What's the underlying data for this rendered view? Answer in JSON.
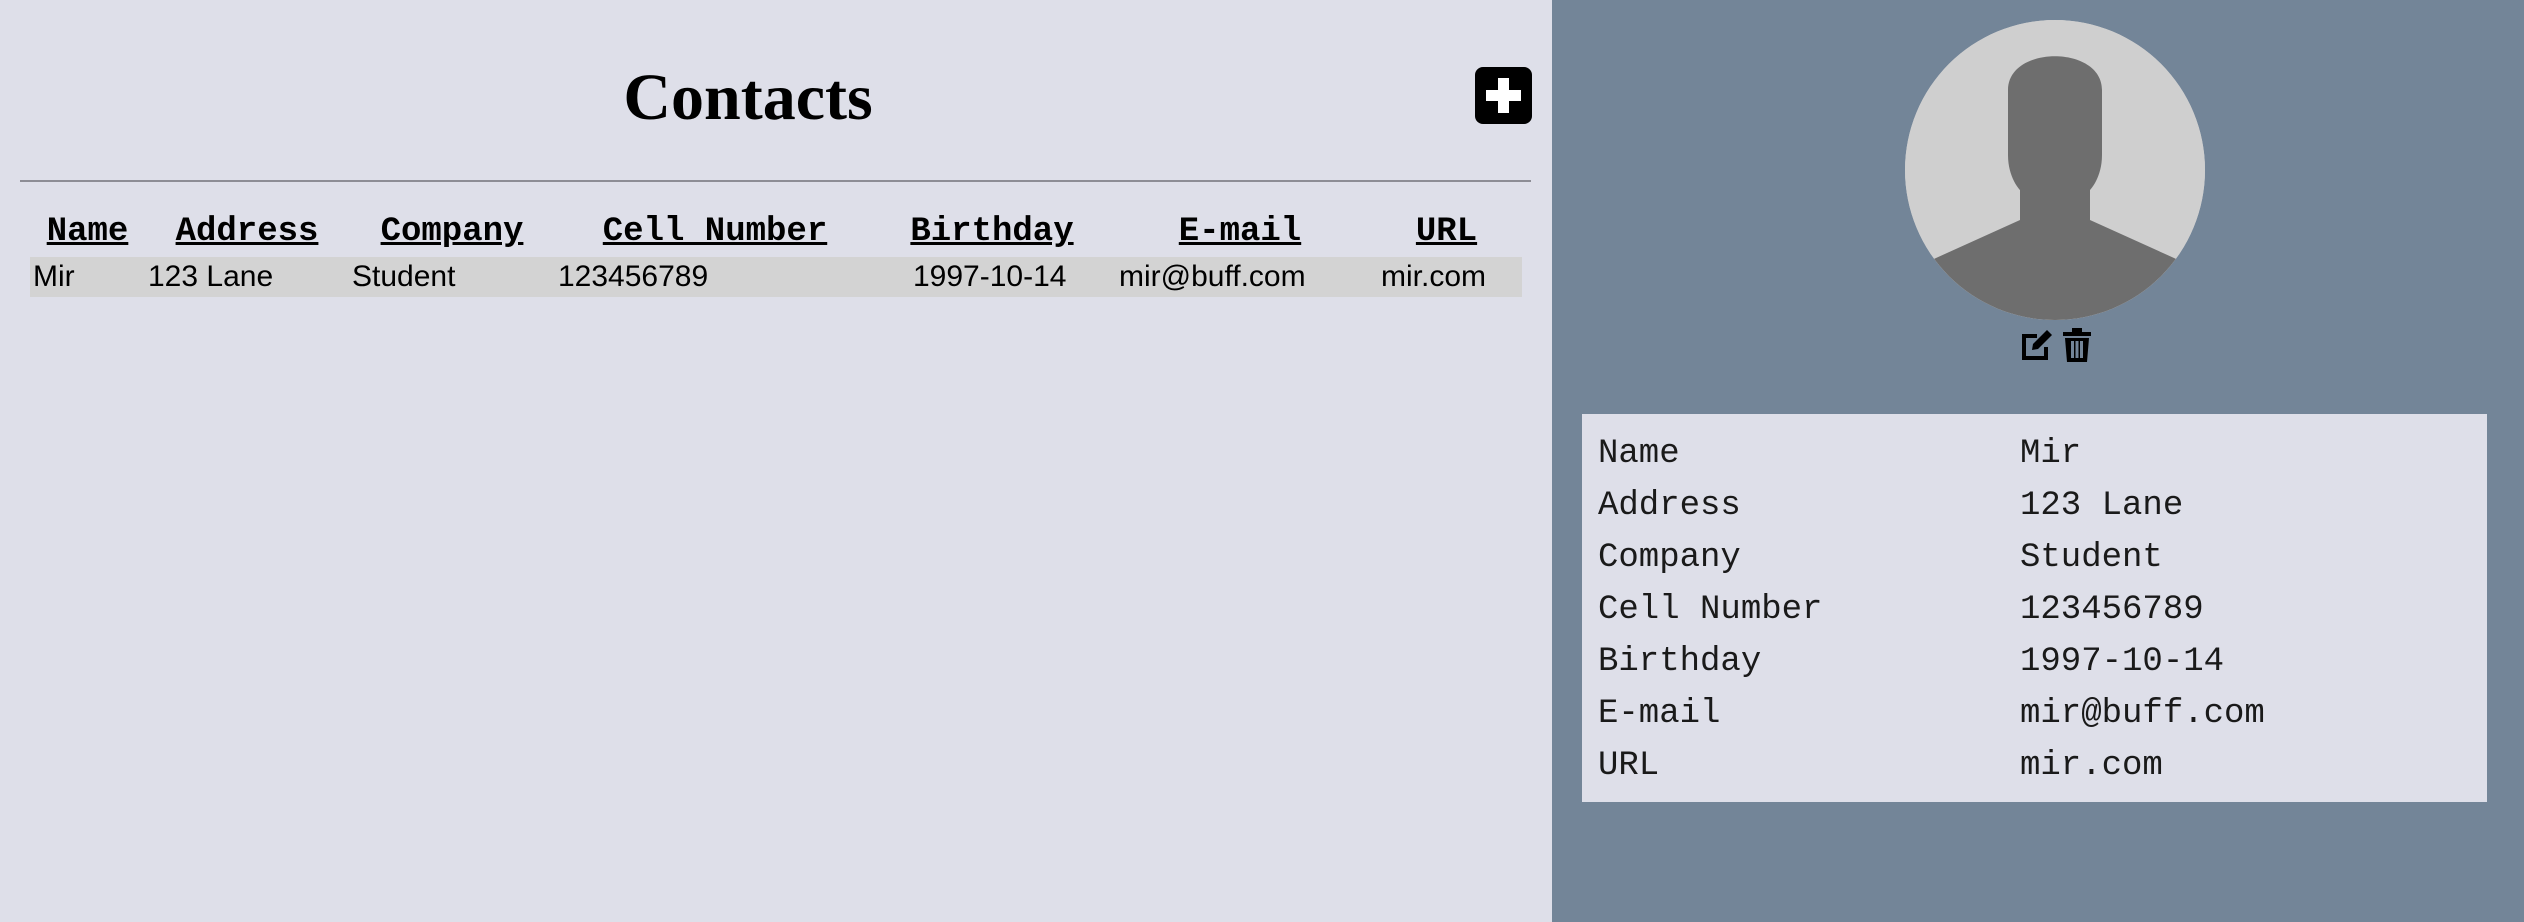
{
  "contacts_pane": {
    "title": "Contacts",
    "columns": [
      "Name",
      "Address",
      "Company",
      "Cell Number",
      "Birthday",
      "E-mail",
      "URL"
    ],
    "rows": [
      {
        "name": "Mir",
        "address": "123 Lane",
        "company": "Student",
        "cell": "123456789",
        "birthday": "1997-10-14",
        "email": "mir@buff.com",
        "url": "mir.com"
      }
    ]
  },
  "detail_pane": {
    "fields": [
      {
        "label": "Name",
        "value": "Mir"
      },
      {
        "label": "Address",
        "value": "123 Lane"
      },
      {
        "label": "Company",
        "value": "Student"
      },
      {
        "label": "Cell Number",
        "value": "123456789"
      },
      {
        "label": "Birthday",
        "value": "1997-10-14"
      },
      {
        "label": "E-mail",
        "value": "mir@buff.com"
      },
      {
        "label": "URL",
        "value": "mir.com"
      }
    ]
  },
  "icons": {
    "add": "plus-square-icon",
    "avatar": "user-silhouette-icon",
    "edit": "edit-icon",
    "delete": "trash-icon"
  },
  "colors": {
    "left_background": "#dedfe9",
    "right_background": "#738598",
    "selected_row": "#d3d3d3",
    "avatar_background": "#cfcfcf",
    "avatar_figure": "#6e6e6e"
  }
}
